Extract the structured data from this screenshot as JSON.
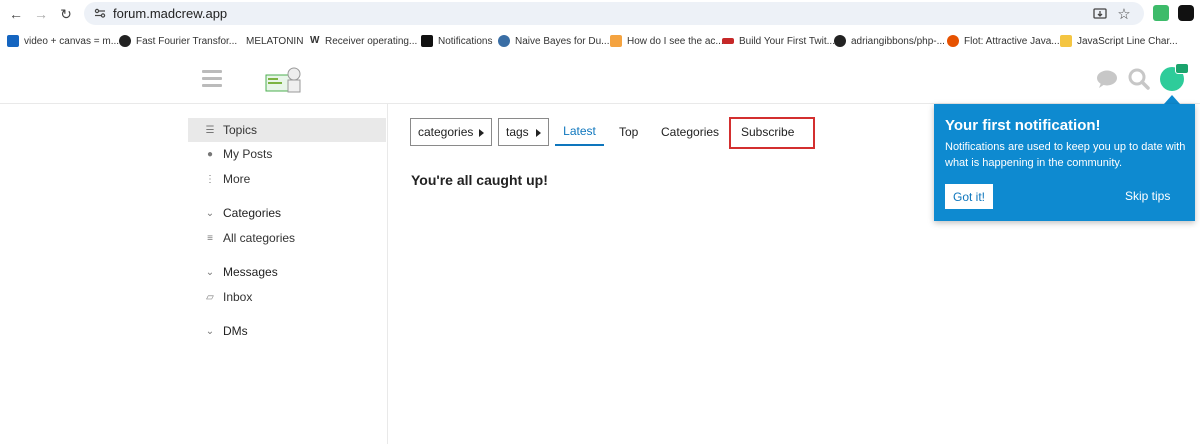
{
  "browser": {
    "url": "forum.madcrew.app",
    "bookmarks": [
      {
        "label": "video + canvas = m...",
        "color": "#1565c0"
      },
      {
        "label": "Fast Fourier Transfor...",
        "color": "#222222"
      },
      {
        "label": "MELATONIN",
        "color": "#ffffff"
      },
      {
        "label": "Receiver operating...",
        "color": "#ffffff"
      },
      {
        "label": "Notifications",
        "color": "#111111"
      },
      {
        "label": "Naive Bayes for Du...",
        "color": "#3a6ea5"
      },
      {
        "label": "How do I see the ac...",
        "color": "#f4a340"
      },
      {
        "label": "Build Your First Twit...",
        "color": "#c62828"
      },
      {
        "label": "adriangibbons/php-...",
        "color": "#222222"
      },
      {
        "label": "Flot: Attractive Java...",
        "color": "#e65100"
      },
      {
        "label": "JavaScript Line Char...",
        "color": "#f4c542"
      }
    ]
  },
  "sidebar": {
    "items": [
      {
        "label": "Topics",
        "icon": "layers-icon"
      },
      {
        "label": "My Posts",
        "icon": "user-icon"
      },
      {
        "label": "More",
        "icon": "more-vertical-icon"
      }
    ],
    "categories_header": "Categories",
    "all_categories": "All categories",
    "messages_header": "Messages",
    "inbox": "Inbox",
    "dms_header": "DMs"
  },
  "main": {
    "categories_dropdown": "categories",
    "tags_dropdown": "tags",
    "tabs": [
      "Latest",
      "Top",
      "Categories",
      "Subscribe"
    ],
    "active_tab": "Latest",
    "empty_message": "You're all caught up!"
  },
  "tip": {
    "title": "Your first notification!",
    "body": "Notifications are used to keep you up to date with what is happening in the community.",
    "got_it": "Got it!",
    "skip": "Skip tips"
  },
  "colors": {
    "accent": "#0e76bd",
    "tip_bg": "#0e8ad0",
    "highlight": "#d32f2f"
  }
}
